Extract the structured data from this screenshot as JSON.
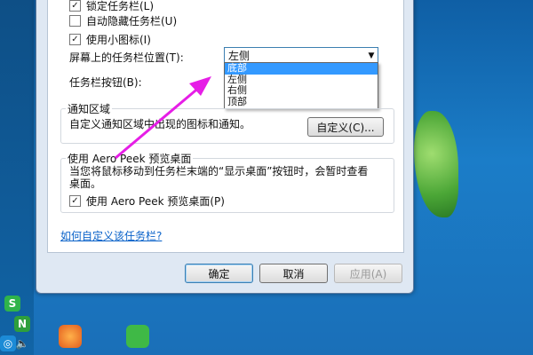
{
  "taskbar_options": {
    "lock_taskbar": {
      "label": "锁定任务栏(L)",
      "checked": true
    },
    "auto_hide": {
      "label": "自动隐藏任务栏(U)",
      "checked": false
    },
    "small_icons": {
      "label": "使用小图标(I)",
      "checked": true
    },
    "location_label": "屏幕上的任务栏位置(T):",
    "location_value": "左侧",
    "location_options": [
      "底部",
      "左侧",
      "右侧",
      "顶部"
    ],
    "buttons_label": "任务栏按钮(B):"
  },
  "notification_area": {
    "title": "通知区域",
    "description": "自定义通知区域中出现的图标和通知。",
    "customize_button": "自定义(C)..."
  },
  "aero_peek": {
    "title": "使用 Aero Peek 预览桌面",
    "description_line1": "当您将鼠标移动到任务栏末端的“显示桌面”按钮时，会暂时查看",
    "description_line2": "桌面。",
    "checkbox": {
      "label": "使用 Aero Peek 预览桌面(P)",
      "checked": true
    }
  },
  "help_link": "如何自定义该任务栏?",
  "dialog_buttons": {
    "ok": "确定",
    "cancel": "取消",
    "apply": "应用(A)"
  },
  "check_mark": "✓",
  "colors": {
    "selection": "#3399ff",
    "link": "#0a62c9",
    "annotation_arrow": "#e61ee6"
  }
}
